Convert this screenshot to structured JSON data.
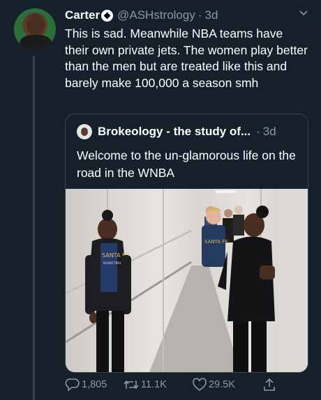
{
  "tweet": {
    "author_name": "Carter",
    "handle": "@ASHstrology",
    "separator": "·",
    "time": "3d",
    "text": "This is sad. Meanwhile NBA teams have their own private jets. The women play better than the men but are treated like this and barely make 100,000 a season smh",
    "icons": {
      "name_badge": "soccer-ball-icon",
      "menu": "chevron-down-icon"
    }
  },
  "quote": {
    "author_name": "Brokeology - the study of...",
    "separator": "·",
    "time": "3d",
    "text": "Welcome to the un-glamorous life on the road in the WNBA",
    "image": {
      "jersey_text": "SANTA FE",
      "jersey_subtext": "BASKETBALL"
    }
  },
  "actions": {
    "reply_count": "1,805",
    "retweet_count": "11.1K",
    "like_count": "29.5K",
    "icons": [
      "reply-icon",
      "retweet-icon",
      "like-icon",
      "share-icon"
    ]
  },
  "colors": {
    "background": "#15202b",
    "border": "#38444d",
    "secondary_text": "#8899a6",
    "primary_text": "#ffffff"
  }
}
